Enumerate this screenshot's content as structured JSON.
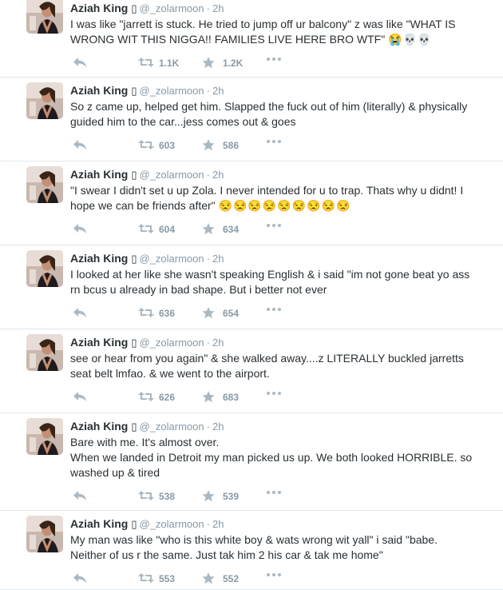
{
  "author": {
    "fullname": "Aziah King",
    "name_glyph": "▯",
    "username": "@_zolarmoon",
    "separator": "·"
  },
  "colors": {
    "text": "#292f33",
    "meta": "#8899a6",
    "icon": "#aab8c2",
    "divider": "#e1e8ed"
  },
  "icons": {
    "reply": "reply-icon",
    "retweet": "retweet-icon",
    "favorite": "star-icon",
    "more": "more-dots-icon"
  },
  "tweets": [
    {
      "time": "2h",
      "text": "I was like \"jarrett is stuck. He tried to jump off ur balcony\" z was like \"WHAT IS\nWRONG WIT THIS NIGGA!! FAMILIES LIVE HERE BRO WTF\"",
      "emoji": "😭💀💀",
      "retweets": "1.1K",
      "favorites": "1.2K"
    },
    {
      "time": "2h",
      "text": "So z came up, helped get him. Slapped the fuck out of him (literally) & physically\nguided him to the car...jess comes out & goes",
      "emoji": "",
      "retweets": "603",
      "favorites": "586"
    },
    {
      "time": "2h",
      "text": "\"I swear I didn't set u up Zola. I never intended for u to trap. Thats why u didnt! I\nhope we can be friends after\"",
      "emoji": "😒😒😒😒😒😒😒😒😒",
      "retweets": "604",
      "favorites": "634"
    },
    {
      "time": "2h",
      "text": "I looked at her like she wasn't speaking English & i said \"im not gone beat yo ass\nrn bcus u already in bad shape. But i better not ever",
      "emoji": "",
      "retweets": "636",
      "favorites": "654"
    },
    {
      "time": "2h",
      "text": "see or hear from you again\" & she walked away....z LITERALLY buckled jarretts\nseat belt lmfao. & we went to the airport.",
      "emoji": "",
      "retweets": "626",
      "favorites": "683"
    },
    {
      "time": "2h",
      "text": "Bare with me. It's almost over.\nWhen we landed in Detroit my man picked us up. We both looked HORRIBLE. so\nwashed up & tired",
      "emoji": "",
      "retweets": "538",
      "favorites": "539"
    },
    {
      "time": "2h",
      "text": "My man was like \"who is this white boy & wats wrong wit yall\" i said \"babe.\nNeither of us r the same. Just tak him 2 his car & tak me home\"",
      "emoji": "",
      "retweets": "553",
      "favorites": "552"
    }
  ]
}
